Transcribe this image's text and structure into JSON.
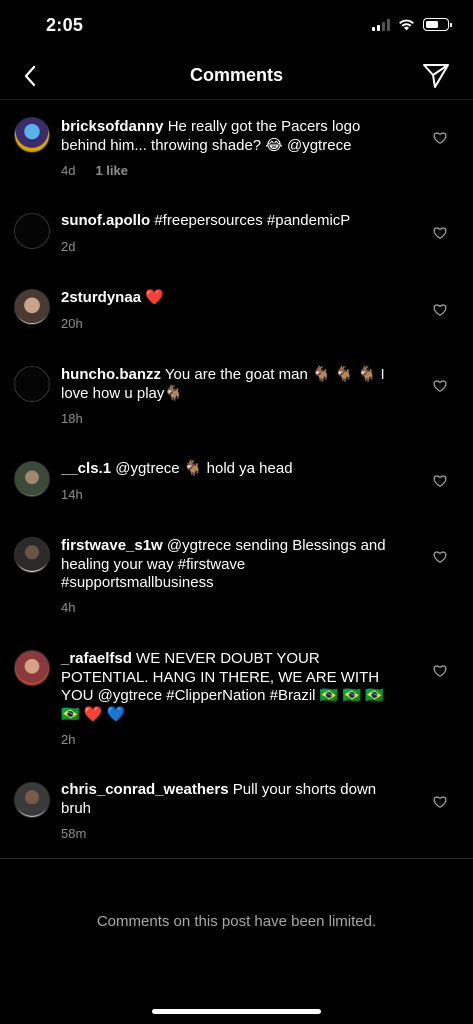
{
  "status": {
    "time": "2:05"
  },
  "nav": {
    "title": "Comments"
  },
  "comments": [
    {
      "username": "bricksofdanny",
      "text": "He really got the Pacers logo behind him... throwing shade? 😂 @ygtrece",
      "time": "4d",
      "likes": "1 like"
    },
    {
      "username": "sunof.apollo",
      "text": "#freepersources #pandemicP",
      "time": "2d",
      "likes": ""
    },
    {
      "username": "2sturdynaa",
      "text": "❤️",
      "time": "20h",
      "likes": ""
    },
    {
      "username": "huncho.banzz",
      "text": "You are the goat man 🐐 🐐 🐐 I love how u play🐐",
      "time": "18h",
      "likes": ""
    },
    {
      "username": "__cls.1",
      "text": "@ygtrece 🐐 hold ya head",
      "time": "14h",
      "likes": ""
    },
    {
      "username": "firstwave_s1w",
      "text": "@ygtrece sending Blessings and healing your way #firstwave #supportsmallbusiness",
      "time": "4h",
      "likes": ""
    },
    {
      "username": "_rafaelfsd",
      "text": "WE NEVER DOUBT YOUR POTENTIAL. HANG IN THERE, WE ARE WITH YOU @ygtrece #ClipperNation #Brazil 🇧🇷 🇧🇷 🇧🇷 🇧🇷 ❤️ 💙",
      "time": "2h",
      "likes": ""
    },
    {
      "username": "chris_conrad_weathers",
      "text": "Pull your shorts down bruh",
      "time": "58m",
      "likes": ""
    }
  ],
  "footer": {
    "limited_text": "Comments on this post have been limited."
  }
}
